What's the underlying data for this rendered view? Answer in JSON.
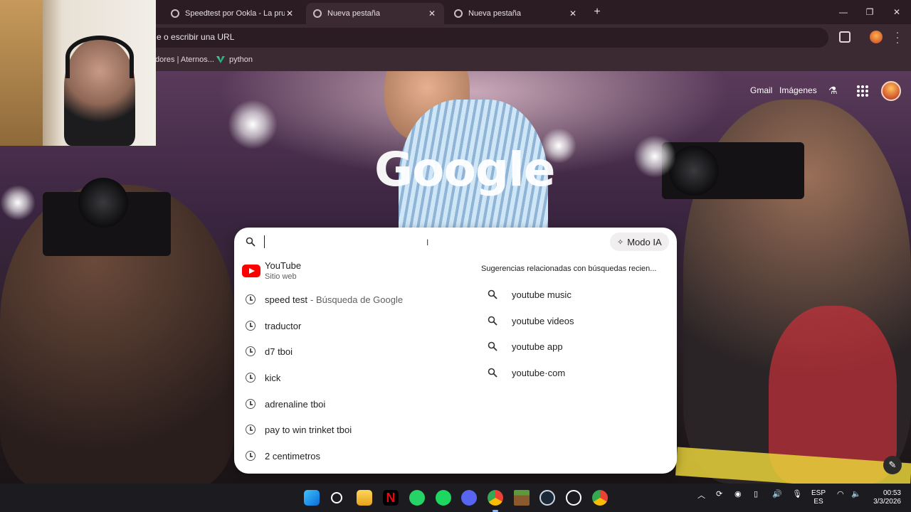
{
  "browser": {
    "tabs": [
      {
        "label": "Speedtest por Ookla - La prueb",
        "active": false
      },
      {
        "label": "Nueva pestaña",
        "active": true
      },
      {
        "label": "Nueva pestaña",
        "active": false
      }
    ],
    "omnibox_text": "e o escribir una URL",
    "bookmarks": [
      {
        "label": "dores | Aternos..."
      },
      {
        "label": "python"
      }
    ]
  },
  "ntp": {
    "logo_text": "Google",
    "links": {
      "gmail": "Gmail",
      "images": "Imágenes"
    }
  },
  "search": {
    "modo_ia_label": "Modo IA",
    "youtube": {
      "title": "YouTube",
      "subtitle": "Sitio web"
    },
    "history": [
      {
        "text": "speed test",
        "hint": "- Búsqueda de Google"
      },
      {
        "text": "traductor",
        "hint": ""
      },
      {
        "text": "d7 tboi",
        "hint": ""
      },
      {
        "text": "kick",
        "hint": ""
      },
      {
        "text": "adrenaline tboi",
        "hint": ""
      },
      {
        "text": "pay to win trinket tboi",
        "hint": ""
      },
      {
        "text": "2 centimetros",
        "hint": ""
      }
    ],
    "related_header": "Sugerencias relacionadas con búsquedas recien...",
    "related": [
      "youtube music",
      "youtube videos",
      "youtube app",
      "youtube·com"
    ]
  },
  "taskbar": {
    "apps": [
      "windows-start",
      "search",
      "file-explorer",
      "netflix",
      "whatsapp",
      "spotify",
      "discord",
      "chrome",
      "minecraft",
      "steam",
      "chatgpt",
      "chrome-canary"
    ],
    "language": {
      "top": "ESP",
      "bottom": "ES"
    },
    "clock": {
      "time": "00:53",
      "date": "3/3/2026"
    }
  },
  "colors": {
    "chrome_dark": "#2a1c22",
    "chrome_mid": "#3b2a31",
    "youtube_red": "#ff0000",
    "taskbar": "#1c1c20"
  }
}
